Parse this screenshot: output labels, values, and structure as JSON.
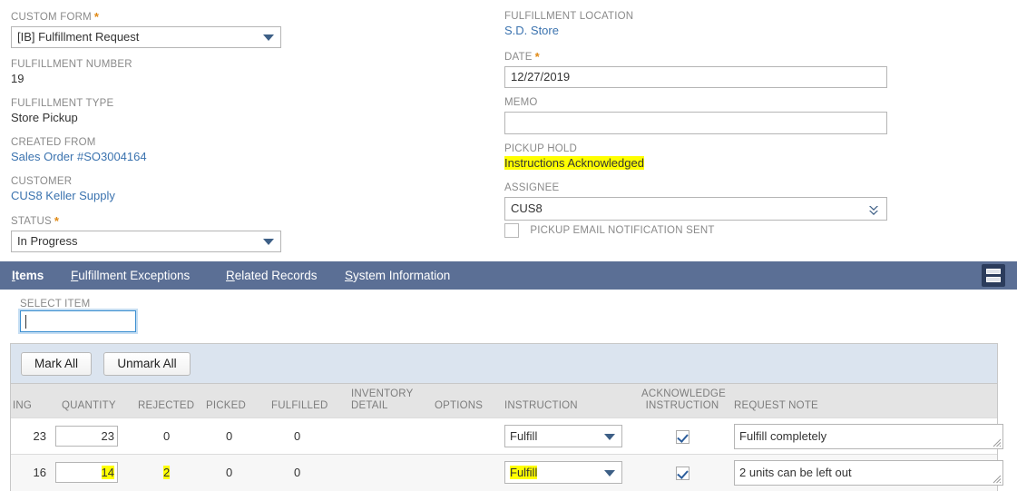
{
  "form": {
    "left_fields": [
      {
        "label": "CUSTOM FORM",
        "required": true,
        "type": "select",
        "value": "[IB] Fulfillment Request"
      },
      {
        "label": "FULFILLMENT NUMBER",
        "required": false,
        "type": "static",
        "value": "19"
      },
      {
        "label": "FULFILLMENT TYPE",
        "required": false,
        "type": "static",
        "value": "Store Pickup"
      },
      {
        "label": "CREATED FROM",
        "required": false,
        "type": "link",
        "value": "Sales Order #SO3004164"
      },
      {
        "label": "CUSTOMER",
        "required": false,
        "type": "link",
        "value": "CUS8 Keller Supply"
      },
      {
        "label": "STATUS",
        "required": true,
        "type": "select",
        "value": "In Progress"
      }
    ],
    "right_fields": [
      {
        "label": "FULFILLMENT LOCATION",
        "required": false,
        "type": "link",
        "value": "S.D. Store"
      },
      {
        "label": "DATE",
        "required": true,
        "type": "text",
        "value": "12/27/2019"
      },
      {
        "label": "MEMO",
        "required": false,
        "type": "text",
        "value": ""
      },
      {
        "label": "PICKUP HOLD",
        "required": false,
        "type": "static-highlight",
        "value": "Instructions Acknowledged"
      },
      {
        "label": "ASSIGNEE",
        "required": false,
        "type": "lookup",
        "value": "CUS8"
      }
    ],
    "pickup_email_checkbox": {
      "label": "PICKUP EMAIL NOTIFICATION SENT",
      "checked": false
    }
  },
  "tabs": [
    {
      "label": "Items",
      "accelerator": "I",
      "active": true
    },
    {
      "label": "Fulfillment Exceptions",
      "accelerator": "F",
      "active": false
    },
    {
      "label": "Related Records",
      "accelerator": "R",
      "active": false
    },
    {
      "label": "System Information",
      "accelerator": "S",
      "active": false
    }
  ],
  "layout_toggle_icon": "list-layout-icon",
  "select_item": {
    "label": "SELECT ITEM",
    "value": "",
    "placeholder": ""
  },
  "sublist": {
    "toolbar": {
      "mark_all_label": "Mark All",
      "unmark_all_label": "Unmark All"
    },
    "columns": [
      "ING",
      "QUANTITY",
      "REJECTED",
      "PICKED",
      "FULFILLED",
      "INVENTORY DETAIL",
      "OPTIONS",
      "INSTRUCTION",
      "ACKNOWLEDGE INSTRUCTION",
      "REQUEST NOTE"
    ],
    "rows": [
      {
        "remaining": "23",
        "quantity": "23",
        "quantity_highlight": false,
        "rejected": "0",
        "rejected_highlight": false,
        "picked": "0",
        "fulfilled": "0",
        "inventory_detail": "",
        "options": "",
        "instruction": "Fulfill",
        "instruction_highlight": false,
        "acknowledge_instruction": true,
        "request_note": "Fulfill completely"
      },
      {
        "remaining": "16",
        "quantity": "14",
        "quantity_highlight": true,
        "rejected": "2",
        "rejected_highlight": true,
        "picked": "0",
        "fulfilled": "0",
        "inventory_detail": "",
        "options": "",
        "instruction": "Fulfill",
        "instruction_highlight": true,
        "acknowledge_instruction": true,
        "request_note": "2 units can be left out"
      }
    ]
  },
  "colors": {
    "tab_bar": "#5b6f95",
    "toggle_button": "#2b3c5c",
    "toolbar_bg": "#dbe4ef",
    "header_bg": "#e4e4e4",
    "highlight": "#ffff00",
    "link": "#3b73af",
    "required_star": "#e08a16",
    "accent_caret": "#3d5f86"
  }
}
